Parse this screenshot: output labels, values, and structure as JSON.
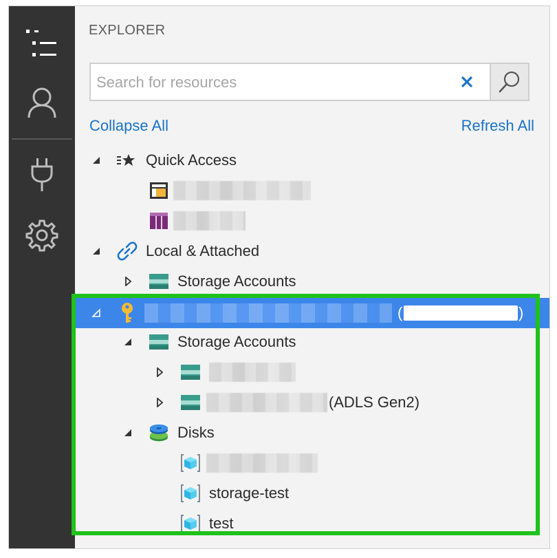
{
  "explorer": {
    "title": "EXPLORER",
    "search": {
      "placeholder": "Search for resources",
      "value": ""
    },
    "collapse_all": "Collapse All",
    "refresh_all": "Refresh All"
  },
  "tree": {
    "quick_access": "Quick Access",
    "local_attached": "Local & Attached",
    "local_storage_accounts": "Storage Accounts",
    "subscription_paren_open": "(",
    "subscription_paren_close": ")",
    "sub_storage_accounts": "Storage Accounts",
    "adls_suffix": "(ADLS Gen2)",
    "disks": "Disks",
    "disk_items": [
      "storage-test",
      "test"
    ]
  },
  "colors": {
    "selection": "#3c86ea",
    "highlight_border": "#1fc21a",
    "link": "#1a73c8",
    "activity_bar": "#333333"
  },
  "icons": {
    "activity": [
      "explorer-list-icon",
      "account-icon",
      "plug-icon",
      "settings-gear-icon"
    ],
    "tree": [
      "quick-access-icon",
      "table-icon",
      "queue-icon",
      "link-icon",
      "storage-account-icon",
      "key-icon",
      "disks-icon",
      "disk-cube-icon"
    ]
  }
}
